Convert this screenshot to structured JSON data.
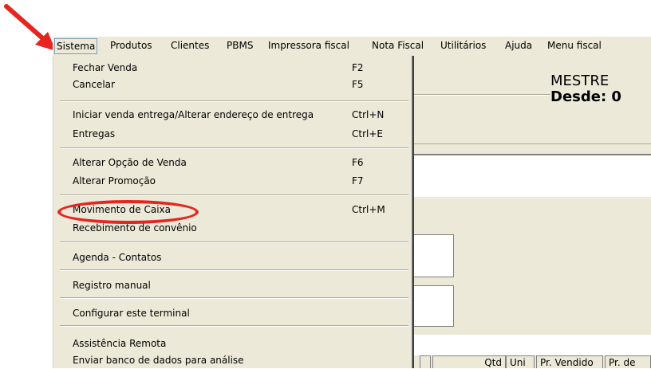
{
  "menubar": {
    "items": [
      "Sistema",
      "Produtos",
      "Clientes",
      "PBMS",
      "Impressora fiscal",
      "Nota Fiscal",
      "Utilitários",
      "Ajuda",
      "Menu fiscal"
    ]
  },
  "info": {
    "line1": "MESTRE",
    "line2": "Desde: 0"
  },
  "dropdown": {
    "items": [
      {
        "label": "Fechar Venda",
        "shortcut": "F2"
      },
      {
        "label": "Cancelar",
        "shortcut": "F5"
      },
      {
        "label": "Iniciar venda entrega/Alterar endereço de entrega",
        "shortcut": "Ctrl+N"
      },
      {
        "label": "Entregas",
        "shortcut": "Ctrl+E"
      },
      {
        "label": "Alterar Opção de Venda",
        "shortcut": "F6"
      },
      {
        "label": "Alterar Promoção",
        "shortcut": "F7"
      },
      {
        "label": "Movimento de Caixa",
        "shortcut": "Ctrl+M"
      },
      {
        "label": "Recebimento de convênio",
        "shortcut": ""
      },
      {
        "label": "Agenda - Contatos",
        "shortcut": ""
      },
      {
        "label": "Registro manual",
        "shortcut": ""
      },
      {
        "label": "Configurar este terminal",
        "shortcut": ""
      },
      {
        "label": "Assistência Remota",
        "shortcut": ""
      },
      {
        "label": "Enviar banco de dados para análise",
        "shortcut": ""
      }
    ]
  },
  "grid": {
    "headers": [
      "Qtd",
      "Uni",
      "Pr. Vendido",
      "Pr. de"
    ]
  },
  "annotation": {
    "color": "#e52620"
  }
}
